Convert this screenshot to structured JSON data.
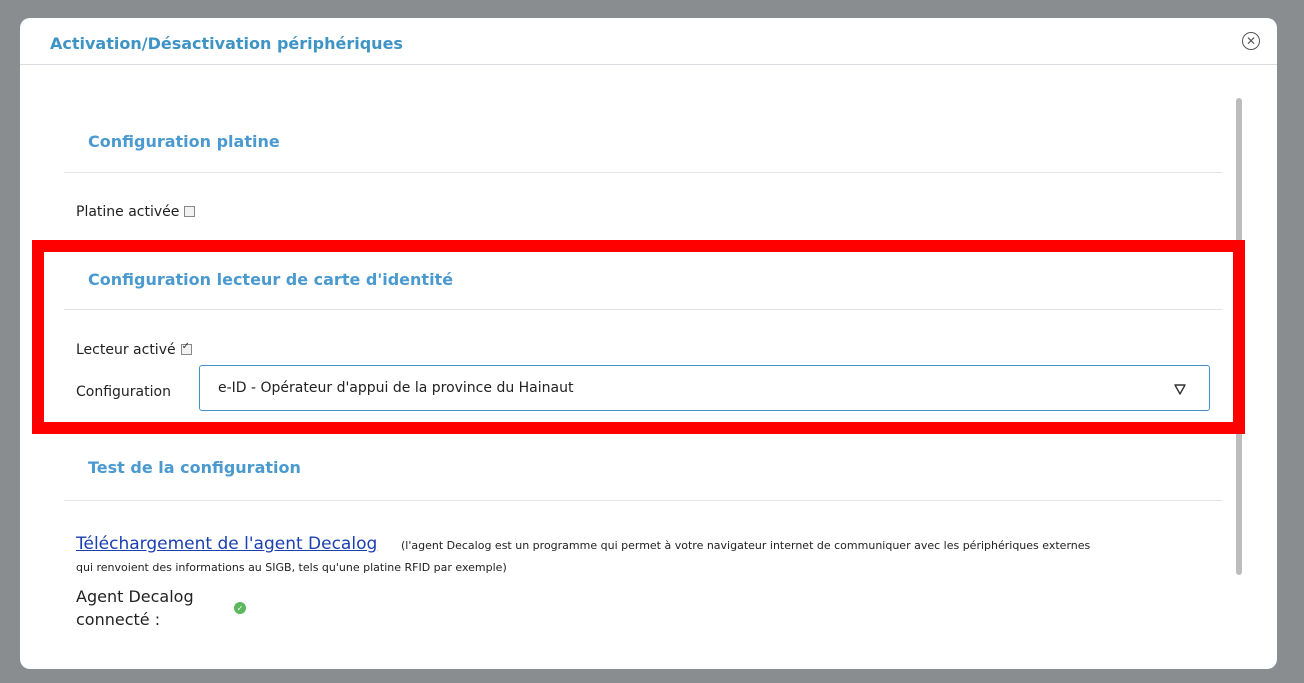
{
  "modal": {
    "title": "Activation/Désactivation périphériques",
    "close_icon": "close-circle-icon"
  },
  "platine": {
    "section_title": "Configuration platine",
    "label": "Platine activée",
    "checked": false
  },
  "lecteur": {
    "section_title": "Configuration lecteur de carte d'identité",
    "label": "Lecteur activé",
    "checked": true,
    "config_label": "Configuration",
    "config_value": "e-ID - Opérateur d'appui de la province du Hainaut"
  },
  "test": {
    "section_title": "Test de la configuration",
    "link_text": "Téléchargement de l'agent Decalog",
    "note_line1": "(l'agent Decalog est un programme qui permet à votre navigateur internet de communiquer avec les périphériques externes",
    "note_line2": "qui renvoient des informations au SIGB, tels qu'une platine RFID par exemple)",
    "agent_label_line1": "Agent Decalog",
    "agent_label_line2": "connecté :",
    "status_icon": "check-circle-icon"
  },
  "colors": {
    "accent": "#3f94c6",
    "highlight": "#ff0000",
    "status_ok": "#5cb85c"
  }
}
